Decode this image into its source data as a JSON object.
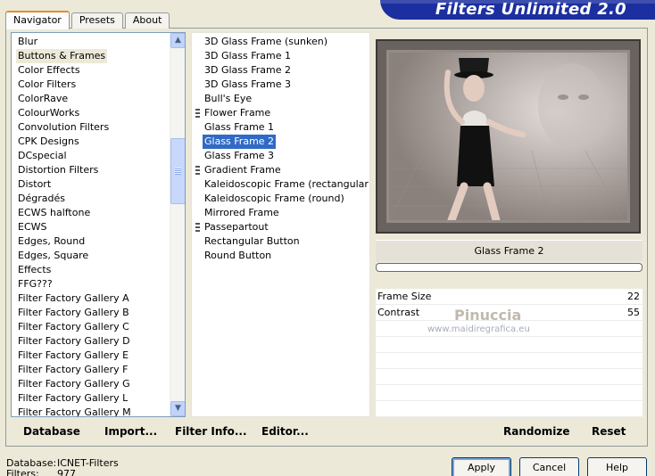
{
  "tabs": [
    {
      "label": "Navigator",
      "active": true
    },
    {
      "label": "Presets",
      "active": false
    },
    {
      "label": "About",
      "active": false
    }
  ],
  "banner": {
    "title": "Filters Unlimited 2.0"
  },
  "categories": {
    "selected": "Buttons & Frames",
    "items": [
      "Blur",
      "Buttons & Frames",
      "Color Effects",
      "Color Filters",
      "ColorRave",
      "ColourWorks",
      "Convolution Filters",
      "CPK Designs",
      "DCspecial",
      "Distortion Filters",
      "Distort",
      "Dégradés",
      "ECWS halftone",
      "ECWS",
      "Edges, Round",
      "Edges, Square",
      "Effects",
      "FFG???",
      "Filter Factory Gallery A",
      "Filter Factory Gallery B",
      "Filter Factory Gallery C",
      "Filter Factory Gallery D",
      "Filter Factory Gallery E",
      "Filter Factory Gallery F",
      "Filter Factory Gallery G",
      "Filter Factory Gallery L",
      "Filter Factory Gallery M"
    ]
  },
  "filters": {
    "selected": "Glass Frame 2",
    "items": [
      {
        "label": "3D Glass Frame (sunken)",
        "group": false
      },
      {
        "label": "3D Glass Frame 1",
        "group": false
      },
      {
        "label": "3D Glass Frame 2",
        "group": false
      },
      {
        "label": "3D Glass Frame 3",
        "group": false
      },
      {
        "label": "Bull's Eye",
        "group": false
      },
      {
        "label": "Flower Frame",
        "group": true
      },
      {
        "label": "Glass Frame 1",
        "group": false
      },
      {
        "label": "Glass Frame 2",
        "group": false
      },
      {
        "label": "Glass Frame 3",
        "group": false
      },
      {
        "label": "Gradient Frame",
        "group": true
      },
      {
        "label": "Kaleidoscopic Frame (rectangular)",
        "group": false
      },
      {
        "label": "Kaleidoscopic Frame (round)",
        "group": false
      },
      {
        "label": "Mirrored Frame",
        "group": false
      },
      {
        "label": "Passepartout",
        "group": true
      },
      {
        "label": "Rectangular Button",
        "group": false
      },
      {
        "label": "Round Button",
        "group": false
      }
    ]
  },
  "preview": {
    "filter_name": "Glass Frame 2",
    "progress": 0
  },
  "params": [
    {
      "label": "Frame Size",
      "value": "22"
    },
    {
      "label": "Contrast",
      "value": "55"
    }
  ],
  "watermark": {
    "name": "Pinuccia",
    "url": "www.maidiregrafica.eu"
  },
  "left_buttons": {
    "database": "Database",
    "import": "Import...",
    "filter_info": "Filter Info...",
    "editor": "Editor..."
  },
  "right_buttons": {
    "randomize": "Randomize",
    "reset": "Reset"
  },
  "status": {
    "database_label": "Database:",
    "database_value": "ICNET-Filters",
    "filters_label": "Filters:",
    "filters_value": "977"
  },
  "dialog_buttons": {
    "apply": "Apply",
    "cancel": "Cancel",
    "help": "Help"
  },
  "colors": {
    "selection": "#316ac5",
    "banner": "#1c2fa0",
    "dialog_bg": "#ece9d8"
  }
}
